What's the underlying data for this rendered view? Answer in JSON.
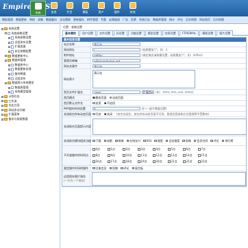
{
  "logo": "EmpireCMS",
  "topnav": [
    {
      "label": "系统"
    },
    {
      "label": "信息"
    },
    {
      "label": "栏目"
    },
    {
      "label": "模板"
    },
    {
      "label": "用户"
    },
    {
      "label": "插件"
    },
    {
      "label": "其他"
    }
  ],
  "subnav": [
    "模板管理",
    "数据更新",
    "审核",
    "采集",
    "数据备份",
    "全站替换",
    "更新缓存",
    "附件管理",
    "专题",
    "友情链接",
    "广告",
    "投票",
    "系统日志",
    "数据库管理",
    "统计",
    "评论",
    "后台地图",
    "网站首页",
    "后台地图"
  ],
  "sidebar": [
    {
      "label": "系统设置",
      "level": 0,
      "type": "folder"
    },
    {
      "label": "系统参数设置",
      "level": 1,
      "type": "page"
    },
    {
      "label": "系统参数设置",
      "level": 2,
      "type": "page"
    },
    {
      "label": "远程发布设置",
      "level": 2,
      "type": "page"
    },
    {
      "label": "扩展变量",
      "level": 2,
      "type": "page"
    },
    {
      "label": "安全参数配置",
      "level": 2,
      "type": "page"
    },
    {
      "label": "数据更新中心",
      "level": 1,
      "type": "folder"
    },
    {
      "label": "数据库管理",
      "level": 1,
      "type": "folder"
    },
    {
      "label": "数据库中心",
      "level": 2,
      "type": "page"
    },
    {
      "label": "数据更新处理",
      "level": 2,
      "type": "page"
    },
    {
      "label": "备份数据",
      "level": 2,
      "type": "page"
    },
    {
      "label": "远程发布",
      "level": 2,
      "type": "page"
    },
    {
      "label": "数据表与系统模型",
      "level": 1,
      "type": "folder"
    },
    {
      "label": "数据表管理",
      "level": 2,
      "type": "page"
    },
    {
      "label": "系统模型管理",
      "level": 2,
      "type": "page"
    },
    {
      "label": "计划任务",
      "level": 0,
      "type": "folder"
    },
    {
      "label": "工作流",
      "level": 0,
      "type": "folder"
    },
    {
      "label": "优化方案",
      "level": 0,
      "type": "folder"
    },
    {
      "label": "网站多访问端",
      "level": 0,
      "type": "folder"
    },
    {
      "label": "扩展菜单",
      "level": 0,
      "type": "folder"
    },
    {
      "label": "备份与恢复数据",
      "level": 0,
      "type": "folder"
    }
  ],
  "breadcrumb": "位置：参数设置",
  "tabs": [
    "基本属性",
    "用户设置",
    "文件设置",
    "JS设置",
    "功能设置",
    "模型设置",
    "信息设置",
    "FTP/EMAIL",
    "模版设置",
    "图片设置"
  ],
  "section_title": "基本信息设置",
  "fields": {
    "site_name": {
      "label": "站点名称",
      "value": "演示站"
    },
    "site_url": {
      "label": "网站地址",
      "value": "/",
      "hint": "(结尾需加\"/\"，如：/)"
    },
    "attach_url": {
      "label": "附件地址",
      "value": "/d/file/",
      "hint": "(绑定域名请按需设置，结尾需加\"/\"，如：/d/file/)"
    },
    "admin_email": {
      "label": "管理员邮箱",
      "value": "admin@phome.net"
    },
    "keywords": {
      "label": "网站关键字",
      "value": "演示站"
    },
    "description": {
      "label": "网站简介",
      "value": "演示站"
    },
    "index_ext": {
      "label": "首页文件扩展名",
      "value": ".html",
      "select": "扩展名",
      "hint": "(如：.html,.htm,.xml,.shtml)"
    },
    "index_mode": {
      "label": "首页模式",
      "options": [
        "静态页面",
        "动态页面"
      ],
      "selected": 0
    },
    "index_php_mode": {
      "label": "首页默认文件名",
      "options": [
        "启用",
        "不启用"
      ],
      "selected": 1
    },
    "php_timeout": {
      "label": "PHP超时时间设置",
      "value": "0",
      "hint": "秒 (一般不需要设置)"
    },
    "close_site": {
      "label": "关闭前台所有动态页面",
      "options": [
        "开启",
        "关闭"
      ],
      "selected": 1,
      "hint": "(前台关闭后，前台所有动态页面不可用，管理员登录和后台管理等不受影响)"
    },
    "close_tip": {
      "label": "关闭前台页面提示内容",
      "value": ""
    },
    "close_modules": {
      "label": "关闭前台模块相关功能",
      "options": [
        "下载",
        "电影",
        "商城",
        "在线支付",
        "RSS",
        "搜索",
        "全站搜索",
        "投稿",
        "会员空间",
        "评论",
        "排行榜"
      ]
    },
    "open_hours": {
      "label": "不开放操作的时间点",
      "hours": [
        "0点",
        "1点",
        "2点",
        "3点",
        "4点",
        "5点",
        "6点",
        "7点",
        "8点",
        "9点",
        "10点",
        "11点",
        "12点",
        "13点",
        "14点",
        "15点",
        "16点",
        "17点",
        "18点",
        "19点",
        "20点",
        "21点",
        "22点",
        "23点"
      ]
    },
    "time_limit": {
      "label": "限定操作时间的操作",
      "options": [
        "注册会员",
        "投稿",
        "评论",
        "留言板"
      ]
    },
    "ip_limit": {
      "label": "远程保存图片域名",
      "sub": "(一行为一个地址)",
      "value": ""
    }
  }
}
